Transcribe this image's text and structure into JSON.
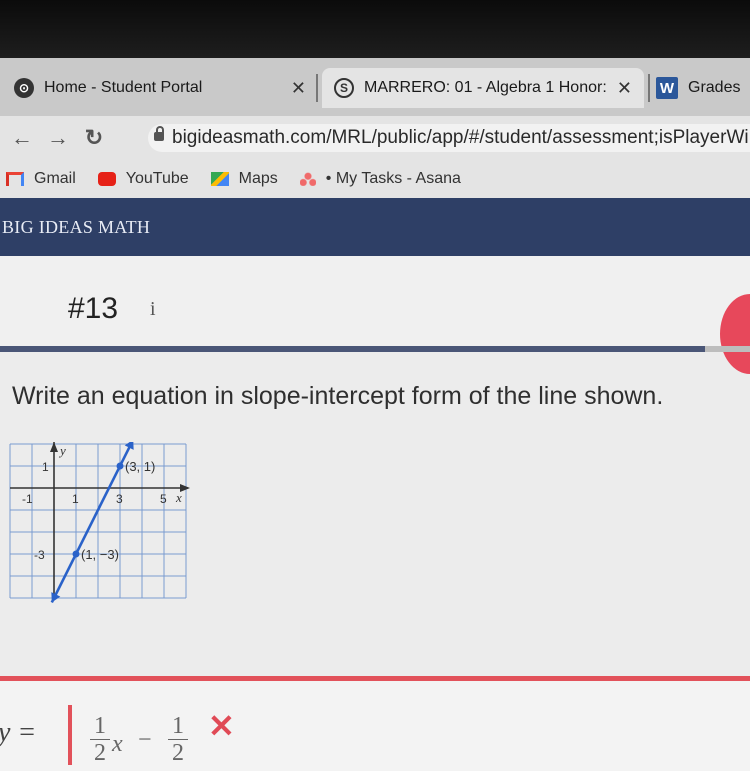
{
  "browser": {
    "tabs": [
      {
        "title": "Home - Student Portal",
        "icon": "portal-icon",
        "active": false
      },
      {
        "title": "MARRERO: 01 - Algebra 1 Honor:",
        "icon": "schoology-icon",
        "active": true
      },
      {
        "title": "Grades",
        "icon": "word-icon",
        "active": false
      }
    ],
    "url": "bigideasmath.com/MRL/public/app/#/student/assessment;isPlayerWi",
    "bookmarks": [
      {
        "label": "Gmail",
        "icon": "gmail-icon"
      },
      {
        "label": "YouTube",
        "icon": "youtube-icon"
      },
      {
        "label": "Maps",
        "icon": "maps-icon"
      },
      {
        "label": "• My Tasks - Asana",
        "icon": "asana-icon"
      }
    ]
  },
  "site": {
    "title": "BIG IDEAS MATH"
  },
  "question": {
    "number": "#13",
    "info_icon": "i",
    "prompt": "Write an equation in slope-intercept form of the line shown.",
    "progress": 0.94
  },
  "graph": {
    "axis_x": "x",
    "axis_y": "y",
    "x_ticks": [
      "-1",
      "1",
      "3",
      "5"
    ],
    "y_ticks": [
      "1",
      "-3"
    ],
    "points": [
      {
        "label": "(3, 1)",
        "x": 3,
        "y": 1
      },
      {
        "label": "(1, −3)",
        "x": 1,
        "y": -3
      }
    ],
    "xlim": [
      -2,
      6
    ],
    "ylim": [
      -5,
      2
    ]
  },
  "answer": {
    "label": "y =",
    "term1_num": "1",
    "term1_den": "2",
    "term1_var": "x",
    "operator": "−",
    "term2_num": "1",
    "term2_den": "2",
    "status": "incorrect",
    "status_icon": "✕"
  }
}
